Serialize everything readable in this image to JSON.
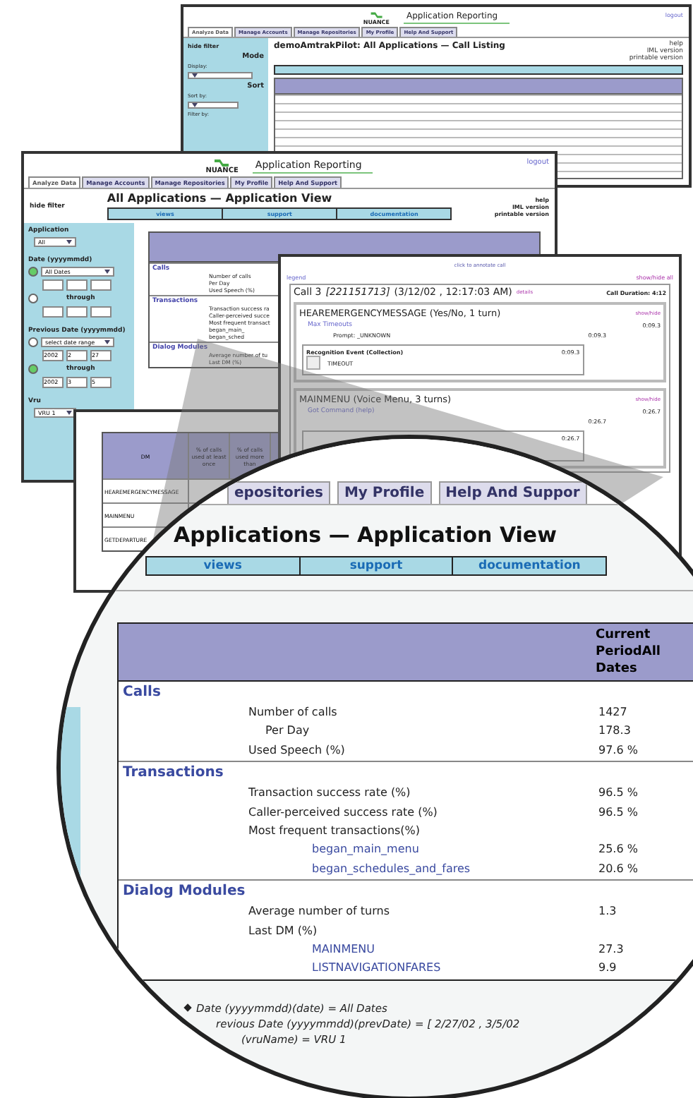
{
  "listing_window": {
    "logo": "NUANCE",
    "title": "Application Reporting",
    "logout": "logout",
    "tabs": [
      {
        "label": "Analyze Data",
        "selected": true
      },
      {
        "label": "Manage Accounts",
        "selected": false
      },
      {
        "label": "Manage Repositories",
        "selected": false
      },
      {
        "label": "My Profile",
        "selected": false
      },
      {
        "label": "Help And Support",
        "selected": false
      }
    ],
    "heading": "demoAmtrakPilot: All Applications — Call Listing",
    "hide_filter": "hide filter",
    "side_headings": [
      "Mode",
      "Sort"
    ],
    "side_labels": [
      "Display:",
      "Sort by:",
      "Filter by:"
    ],
    "side_links": [
      "help",
      "IML version",
      "printable version"
    ]
  },
  "app_window": {
    "logo": "NUANCE",
    "title": "Application Reporting",
    "logout": "logout",
    "tabs": [
      {
        "label": "Analyze Data",
        "selected": true
      },
      {
        "label": "Manage Accounts",
        "selected": false
      },
      {
        "label": "Manage Repositories",
        "selected": false
      },
      {
        "label": "My Profile",
        "selected": false
      },
      {
        "label": "Help And Support",
        "selected": false
      }
    ],
    "hide_filter": "hide filter",
    "heading": "All Applications — Application View",
    "nav": [
      "views",
      "support",
      "documentation"
    ],
    "side_links": [
      "help",
      "IML version",
      "printable version"
    ],
    "filter": [
      {
        "kind": "select",
        "label": "Application",
        "value": "All"
      },
      {
        "kind": "date",
        "label": "Date (yyyymmdd)",
        "value": "All Dates",
        "through_label": "through",
        "range_selected": false
      },
      {
        "kind": "date",
        "label": "Previous Date (yyyymmdd)",
        "value": "select date range",
        "from": [
          "2002",
          "2",
          "27"
        ],
        "through_label": "through",
        "to": [
          "2002",
          "3",
          "5"
        ],
        "range_selected": true
      },
      {
        "kind": "select",
        "label": "Vru",
        "value": "VRU 1"
      }
    ],
    "sections": [
      {
        "title": "Calls",
        "rows": [
          "Number of calls",
          "Per Day",
          "Used Speech (%)"
        ]
      },
      {
        "title": "Transactions",
        "rows": [
          "Transaction success ra",
          "Caller-perceived succe",
          "Most frequent transact",
          "began_main_",
          "began_sched"
        ]
      },
      {
        "title": "Dialog Modules",
        "rows": [
          "Average number of tu",
          "Last DM (%)"
        ]
      }
    ]
  },
  "call_window": {
    "annotate": "click to annotate call",
    "legend": "legend",
    "show_hide_all": "show/hide all",
    "call": "Call 3",
    "call_id": "[221151713]",
    "call_time": "(3/12/02 , 12:17:03 AM)",
    "details": "details",
    "duration": "Call Duration: 4:12",
    "modules": [
      {
        "name": "HEAREMERGENCYMESSAGE (Yes/No, 1 turn)",
        "toggle": "show/hide",
        "event": "Max Timeouts",
        "event_time": "0:09.3",
        "prompt": "Prompt: _UNKNOWN",
        "prompt_time": "0:09.3",
        "recognition": "Recognition Event (Collection)",
        "recognition_time": "0:09.3",
        "result": "TIMEOUT"
      },
      {
        "name": "MAINMENU (Voice Menu, 3 turns)",
        "toggle": "show/hide",
        "event": "Got Command (help)",
        "event_time": "0:26.7",
        "prompt_time": "0:26.7",
        "recognition_time": "0:26.7"
      }
    ]
  },
  "dm_window": {
    "columns": [
      "DM",
      "% of calls used at least once",
      "% of calls used more than"
    ],
    "rows": [
      "HEAREMERGENCYMESSAGE",
      "MAINMENU",
      "GETDEPARTURE"
    ]
  },
  "magnifier": {
    "tabs": [
      {
        "label": "epositories",
        "selected": false
      },
      {
        "label": "My Profile",
        "selected": false
      },
      {
        "label": "Help And Suppor",
        "selected": false
      }
    ],
    "heading": "Applications — Application View",
    "nav": [
      "views",
      "support",
      "documentation"
    ],
    "column": "Current PeriodAll Dates",
    "sections": [
      {
        "title": "Calls",
        "rows": [
          {
            "kind": "metric",
            "label": "Number of calls",
            "value": "1427"
          },
          {
            "kind": "sub",
            "label": "Per Day",
            "value": "178.3"
          },
          {
            "kind": "metric",
            "label": "Used Speech (%)",
            "value": "97.6 %"
          }
        ]
      },
      {
        "title": "Transactions",
        "rows": [
          {
            "kind": "metric",
            "label": "Transaction success rate (%)",
            "value": "96.5 %"
          },
          {
            "kind": "metric",
            "label": "Caller-perceived success rate (%)",
            "value": "96.5 %"
          },
          {
            "kind": "metric",
            "label": "Most frequent transactions(%)"
          },
          {
            "kind": "link",
            "label": "began_main_menu",
            "value": "25.6 %"
          },
          {
            "kind": "link",
            "label": "began_schedules_and_fares",
            "value": "20.6 %"
          }
        ]
      },
      {
        "title": "Dialog Modules",
        "rows": [
          {
            "kind": "metric",
            "label": "Average number of turns",
            "value": "1.3"
          },
          {
            "kind": "metric",
            "label": "Last DM (%)"
          },
          {
            "kind": "link",
            "label": "MAINMENU",
            "value": "27.3"
          },
          {
            "kind": "link",
            "label": "LISTNAVIGATIONFARES",
            "value": "9.9"
          }
        ]
      }
    ],
    "criteria": [
      "Date (yyyymmdd)(date) = All Dates",
      "revious Date (yyyymmdd)(prevDate) = [ 2/27/02 , 3/5/02",
      "(vruName) = VRU 1"
    ]
  }
}
